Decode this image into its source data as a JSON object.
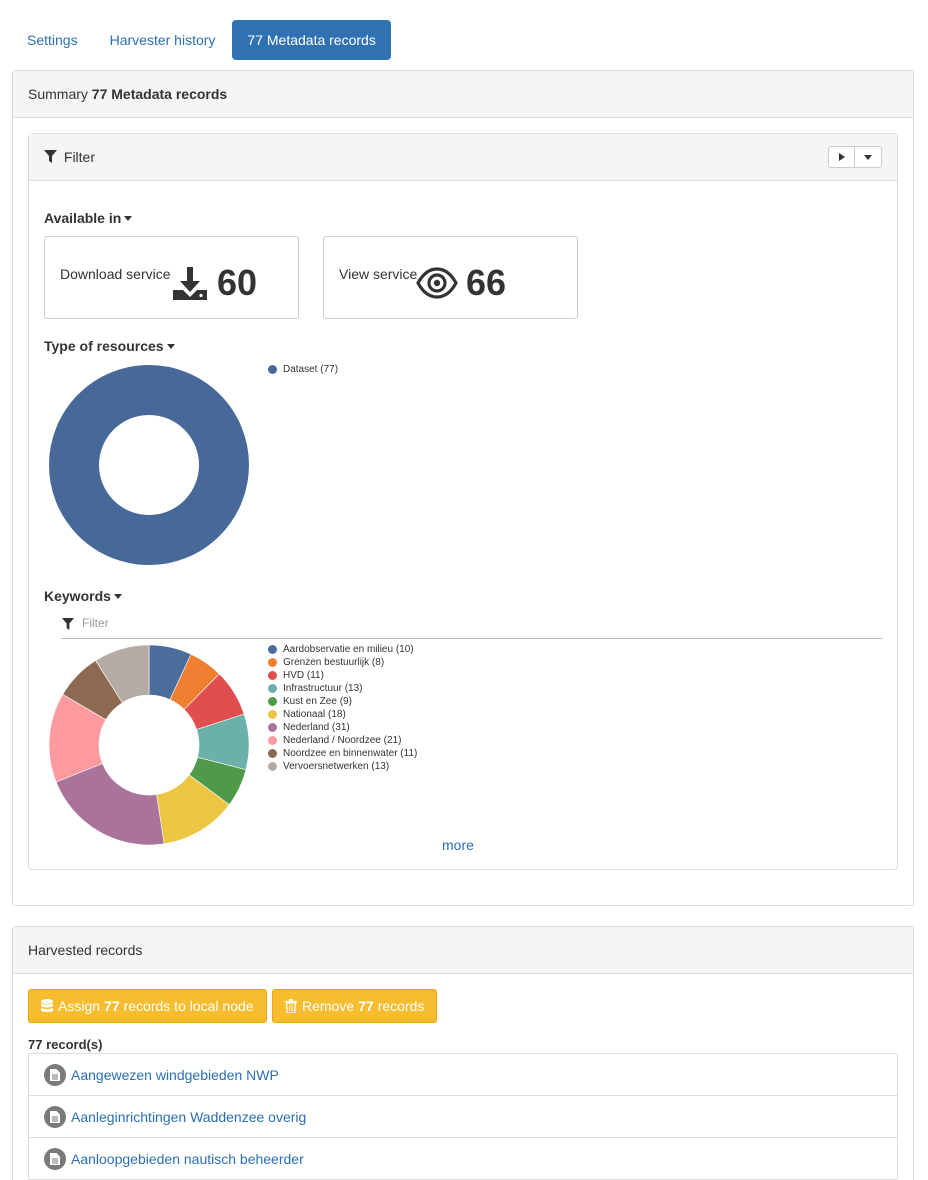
{
  "tabs": [
    {
      "label": "Settings"
    },
    {
      "label": "Harvester history"
    },
    {
      "label": "77 Metadata records"
    }
  ],
  "summary": {
    "heading_prefix": "Summary",
    "heading_bold": "77 Metadata records",
    "filter": {
      "title": "Filter"
    },
    "available_in": {
      "title": "Available in",
      "cards": [
        {
          "label": "Download service",
          "value": "60",
          "icon": "download-icon"
        },
        {
          "label": "View service",
          "value": "66",
          "icon": "eye-icon"
        }
      ]
    },
    "type_of_resources": {
      "title": "Type of resources",
      "items": [
        {
          "label": "Dataset (77)",
          "count": 77,
          "color": "#46699a"
        }
      ]
    },
    "keywords": {
      "title": "Keywords",
      "filter_placeholder": "Filter",
      "items": [
        {
          "label": "Aardobservatie en milieu (10)",
          "count": 10,
          "color": "#4a6d9c"
        },
        {
          "label": "Grenzen bestuurlijk (8)",
          "count": 8,
          "color": "#ef7f30"
        },
        {
          "label": "HVD (11)",
          "count": 11,
          "color": "#df4f4f"
        },
        {
          "label": "Infrastructuur (13)",
          "count": 13,
          "color": "#6bb0a9"
        },
        {
          "label": "Kust en Zee (9)",
          "count": 9,
          "color": "#4f9a48"
        },
        {
          "label": "Nationaal (18)",
          "count": 18,
          "color": "#ecc643"
        },
        {
          "label": "Nederland (31)",
          "count": 31,
          "color": "#a9739a"
        },
        {
          "label": "Nederland / Noordzee (21)",
          "count": 21,
          "color": "#fd9aa0"
        },
        {
          "label": "Noordzee en binnenwater (11)",
          "count": 11,
          "color": "#8c6950"
        },
        {
          "label": "Vervoersnetwerken (13)",
          "count": 13,
          "color": "#b6aba4"
        }
      ],
      "more_label": "more"
    }
  },
  "harvested": {
    "heading": "Harvested records",
    "assign_button": {
      "prefix": "Assign",
      "count": "77",
      "suffix": "records to local node"
    },
    "remove_button": {
      "prefix": "Remove",
      "count": "77",
      "suffix": "records"
    },
    "record_count": "77 record(s)",
    "records": [
      {
        "title": "Aangewezen windgebieden NWP"
      },
      {
        "title": "Aanleginrichtingen Waddenzee overig"
      },
      {
        "title": "Aanloopgebieden nautisch beheerder"
      }
    ]
  }
}
